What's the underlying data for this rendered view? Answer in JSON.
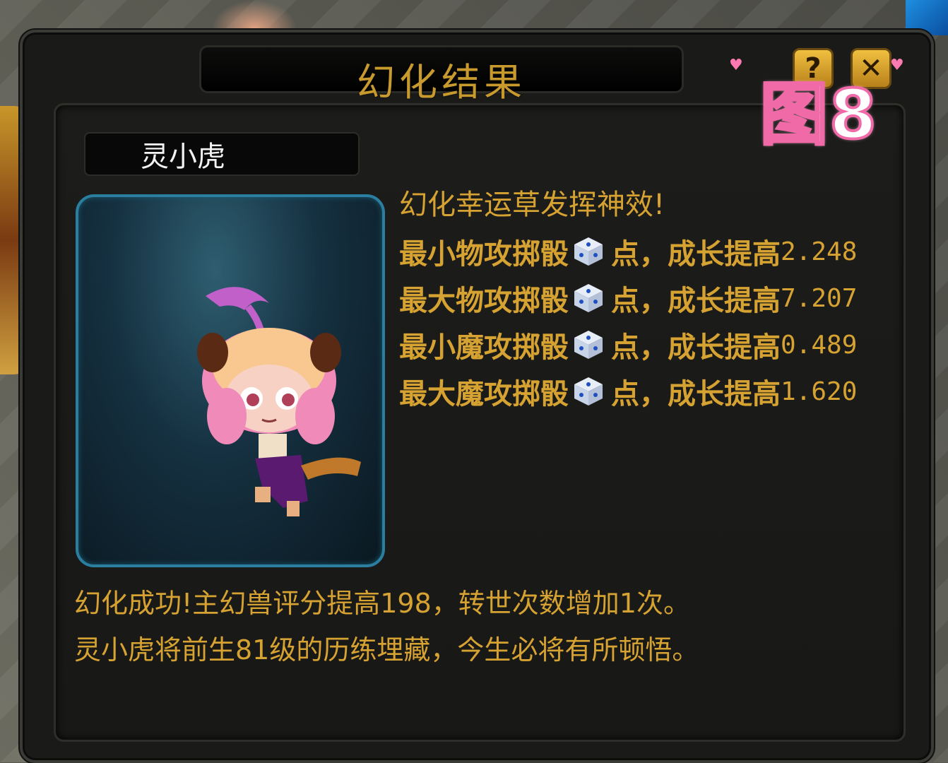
{
  "window": {
    "title": "幻化结果"
  },
  "buttons": {
    "help": "?",
    "close": "✕"
  },
  "pet": {
    "name": "灵小虎"
  },
  "lucky_message": "幻化幸运草发挥神效!",
  "stats": [
    {
      "label": "最小物攻掷骰",
      "suffix": "点，成长提高",
      "value": "2.248"
    },
    {
      "label": "最大物攻掷骰",
      "suffix": "点，成长提高",
      "value": "7.207"
    },
    {
      "label": "最小魔攻掷骰",
      "suffix": "点，成长提高",
      "value": "0.489"
    },
    {
      "label": "最大魔攻掷骰",
      "suffix": "点，成长提高",
      "value": "1.620"
    }
  ],
  "result": {
    "line1": "幻化成功!主幻兽评分提高198，转世次数增加1次。",
    "line2": "灵小虎将前生81级的历练埋藏，今生必将有所顿悟。"
  },
  "overlay_tag": "图8",
  "colors": {
    "gold_text": "#d6a232",
    "title_gold": "#c89a2e",
    "portrait_border": "#2a7fa0",
    "tag_pink": "#f06aa8"
  },
  "icons": {
    "dice": "dice-icon",
    "help": "question-icon",
    "close": "close-icon"
  }
}
